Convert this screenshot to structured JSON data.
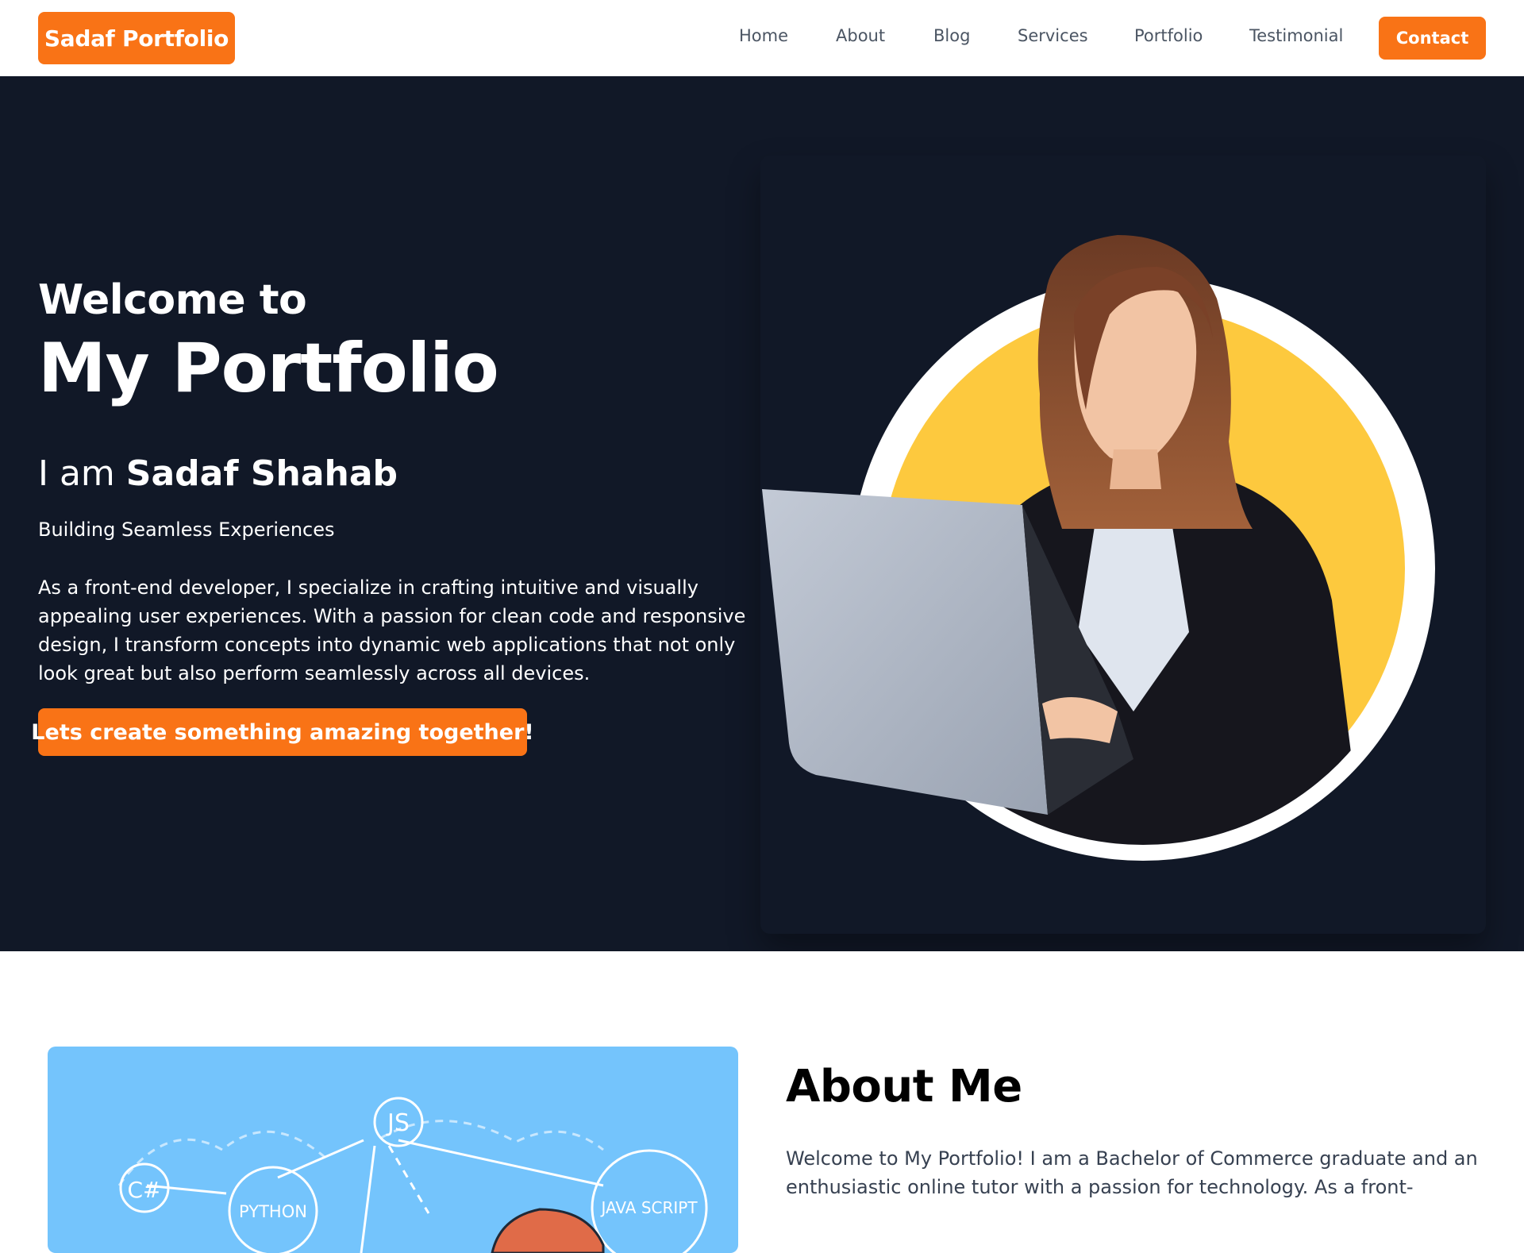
{
  "navbar": {
    "brand": "Sadaf Portfolio",
    "links": [
      "Home",
      "About",
      "Blog",
      "Services",
      "Portfolio",
      "Testimonial"
    ],
    "contact": "Contact"
  },
  "hero": {
    "welcome": "Welcome to",
    "title": "My Portfolio",
    "name_prefix": "I am",
    "name": "Sadaf Shahab",
    "tagline": "Building Seamless Experiences",
    "description": "As a front-end developer, I specialize in crafting intuitive and visually appealing user experiences. With a passion for clean code and responsive design, I transform concepts into dynamic web applications that not only look great but also perform seamlessly across all devices.",
    "cta": "Lets create something amazing together!"
  },
  "about": {
    "title": "About Me",
    "text": "Welcome to My Portfolio! I am a Bachelor of Commerce graduate and an enthusiastic online tutor with a passion for technology. As a front-",
    "illustration_labels": [
      "JS",
      "C#",
      "PYTHON",
      "JAVA SCRIPT"
    ]
  },
  "colors": {
    "accent": "#f97316",
    "hero_bg": "#111827",
    "about_image_bg": "#74c4fc",
    "circle_yellow": "#fdc93e"
  }
}
